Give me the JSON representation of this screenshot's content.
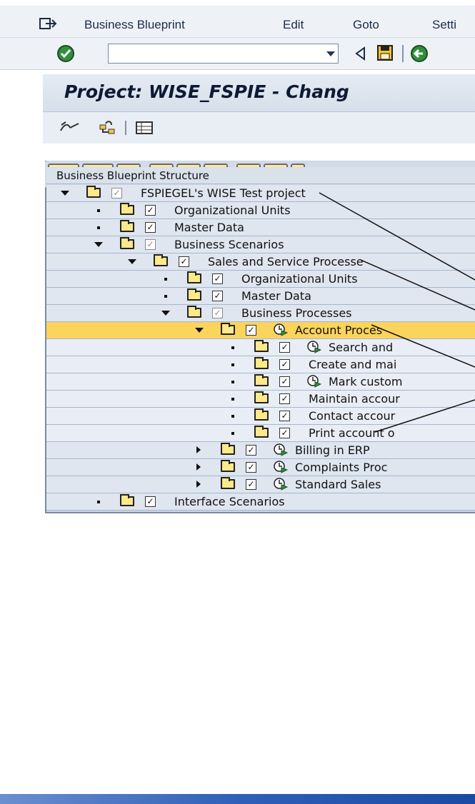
{
  "menubar": {
    "items": [
      "Business Blueprint",
      "Edit",
      "Goto",
      "Setti"
    ]
  },
  "toolbar": {
    "command_value": ""
  },
  "title": {
    "text": "Project: WISE_FSPIE - Chang"
  },
  "tree": {
    "header": "Business Blueprint Structure",
    "rows": [
      {
        "label": "FSPIEGEL's WISE Test project"
      },
      {
        "label": "Organizational Units"
      },
      {
        "label": "Master Data"
      },
      {
        "label": "Business Scenarios"
      },
      {
        "label": "Sales and Service Processe"
      },
      {
        "label": "Organizational Units"
      },
      {
        "label": "Master Data"
      },
      {
        "label": "Business Processes"
      },
      {
        "label": "Account Proces"
      },
      {
        "label": "Search and"
      },
      {
        "label": "Create and mai"
      },
      {
        "label": "Mark custom"
      },
      {
        "label": "Maintain accour"
      },
      {
        "label": "Contact accour"
      },
      {
        "label": "Print account o"
      },
      {
        "label": "Billing in ERP"
      },
      {
        "label": "Complaints Proc"
      },
      {
        "label": "Standard Sales"
      },
      {
        "label": "Interface Scenarios"
      }
    ]
  },
  "icons": {
    "exit": "exit-icon",
    "enter": "green-check-icon",
    "back": "back-arrow-icon",
    "save": "save-icon",
    "process": "process-clock-icon",
    "folder": "folder-icon",
    "checkbox": "checkbox-checked-icon"
  },
  "colors": {
    "selected_row": "#fbd45d",
    "row_bg": "#dfe6f0",
    "title_bg": "#d6dfea"
  }
}
